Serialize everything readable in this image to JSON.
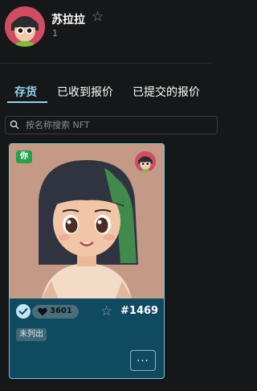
{
  "profile": {
    "username": "苏拉拉",
    "count": "1"
  },
  "tabs": [
    {
      "label": "存货",
      "active": true
    },
    {
      "label": "已收到报价",
      "active": false
    },
    {
      "label": "已提交的报价",
      "active": false
    }
  ],
  "search": {
    "placeholder": "按名称搜索 NFT",
    "value": ""
  },
  "card": {
    "own_badge": "你",
    "likes": "3601",
    "number": "#1469",
    "status": "未列出",
    "more_label": "..."
  },
  "colors": {
    "accent": "#8fd3ee",
    "card_background": "#0f4a60",
    "own_badge": "#27a24c",
    "page_background": "#161718"
  },
  "icons": {
    "favorite": "star-outline-icon",
    "search": "search-icon",
    "likes": "heart-icon",
    "verified": "check-circle-icon"
  }
}
